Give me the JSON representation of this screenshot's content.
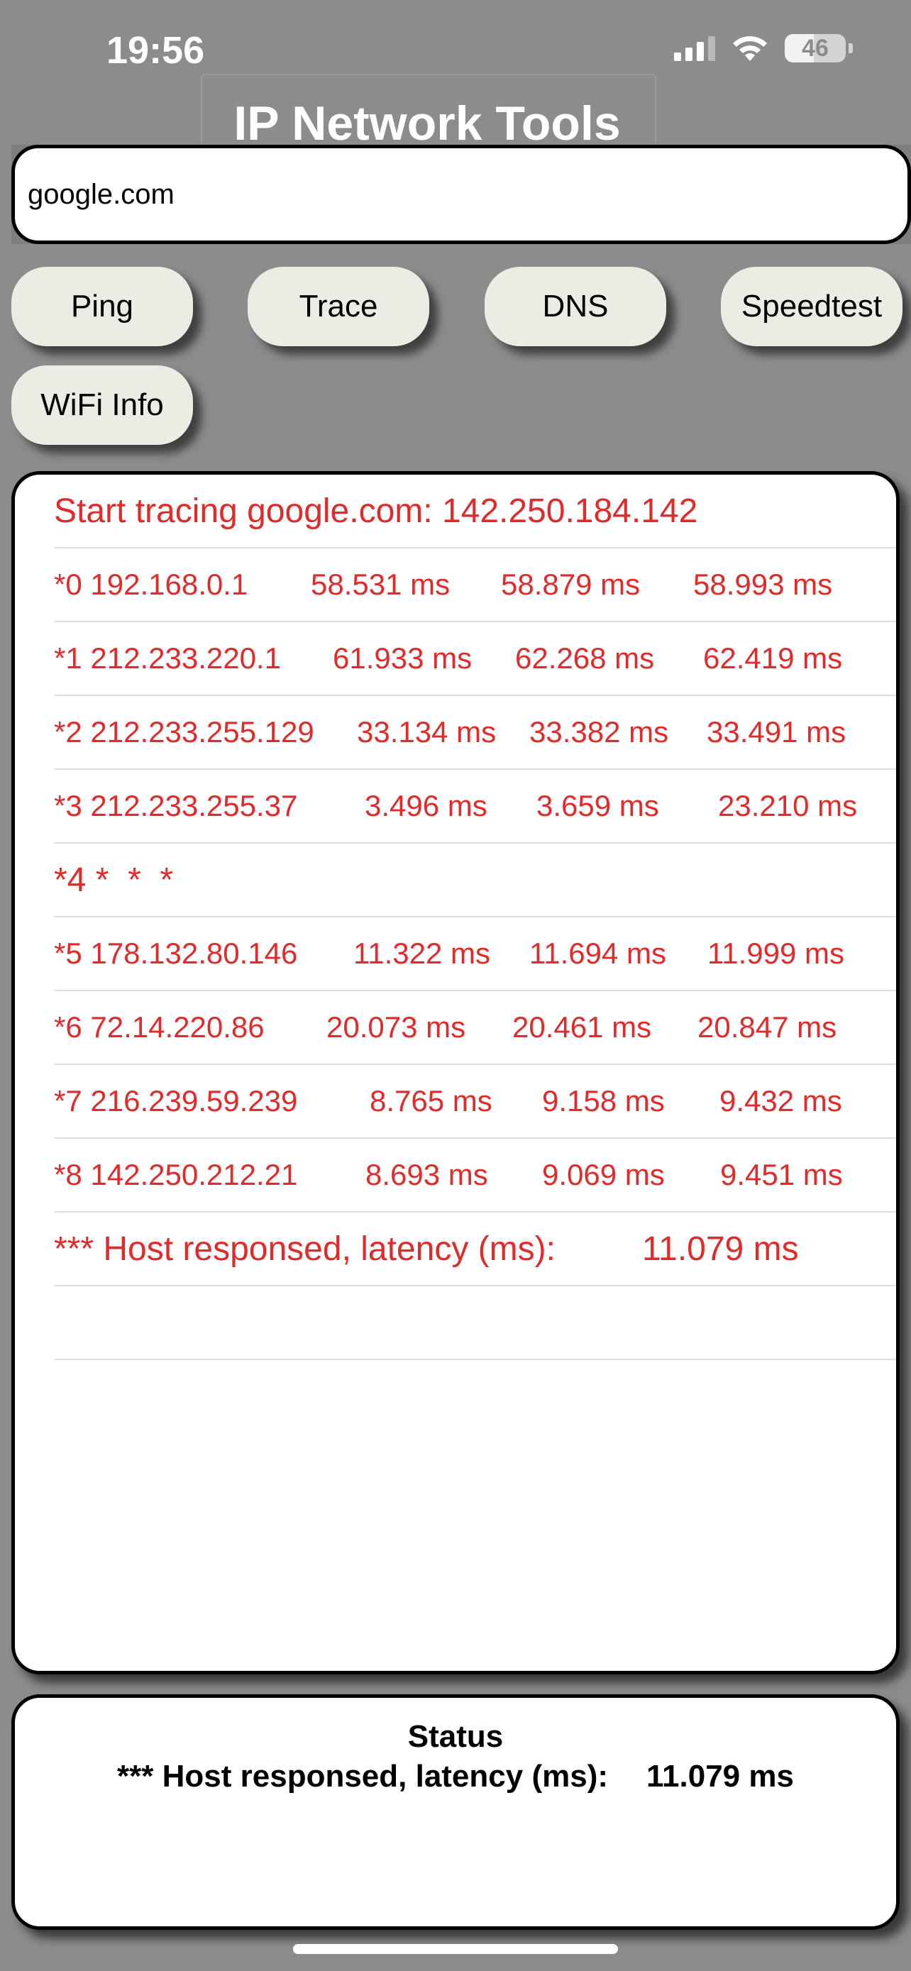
{
  "statusbar": {
    "time": "19:56",
    "battery": "46"
  },
  "app": {
    "title": "IP Network Tools"
  },
  "host_input": {
    "value": "google.com"
  },
  "buttons": {
    "ping": "Ping",
    "trace": "Trace",
    "dns": "DNS",
    "speedtest": "Speedtest",
    "wifi": "WiFi Info"
  },
  "results": {
    "header": "Start tracing google.com: 142.250.184.142",
    "hops": [
      {
        "hop": "*0 192.168.0.1",
        "t1": "58.531 ms",
        "t2": "58.879 ms",
        "t3": "58.993 ms"
      },
      {
        "hop": "*1 212.233.220.1",
        "t1": "61.933 ms",
        "t2": "62.268 ms",
        "t3": "62.419 ms"
      },
      {
        "hop": "*2 212.233.255.129",
        "t1": "33.134 ms",
        "t2": "33.382 ms",
        "t3": "33.491 ms"
      },
      {
        "hop": "*3 212.233.255.37",
        "t1": "3.496 ms",
        "t2": "3.659 ms",
        "t3": "23.210 ms"
      },
      {
        "hop": "*4 *  *  *",
        "t1": "",
        "t2": "",
        "t3": ""
      },
      {
        "hop": "*5 178.132.80.146",
        "t1": "11.322 ms",
        "t2": "11.694 ms",
        "t3": "11.999 ms"
      },
      {
        "hop": "*6 72.14.220.86",
        "t1": "20.073 ms",
        "t2": "20.461 ms",
        "t3": "20.847 ms"
      },
      {
        "hop": "*7 216.239.59.239",
        "t1": "8.765 ms",
        "t2": "9.158 ms",
        "t3": "9.432 ms"
      },
      {
        "hop": "*8 142.250.212.21",
        "t1": "8.693 ms",
        "t2": "9.069 ms",
        "t3": "9.451 ms"
      }
    ],
    "final_label": "*** Host responsed, latency (ms):",
    "final_value": "11.079 ms"
  },
  "status": {
    "title": "Status",
    "label": "*** Host responsed, latency (ms):",
    "value": "11.079 ms"
  },
  "colors": {
    "result_text": "#e12a2a",
    "background": "#8c8c8c",
    "button": "#ecebe4"
  }
}
